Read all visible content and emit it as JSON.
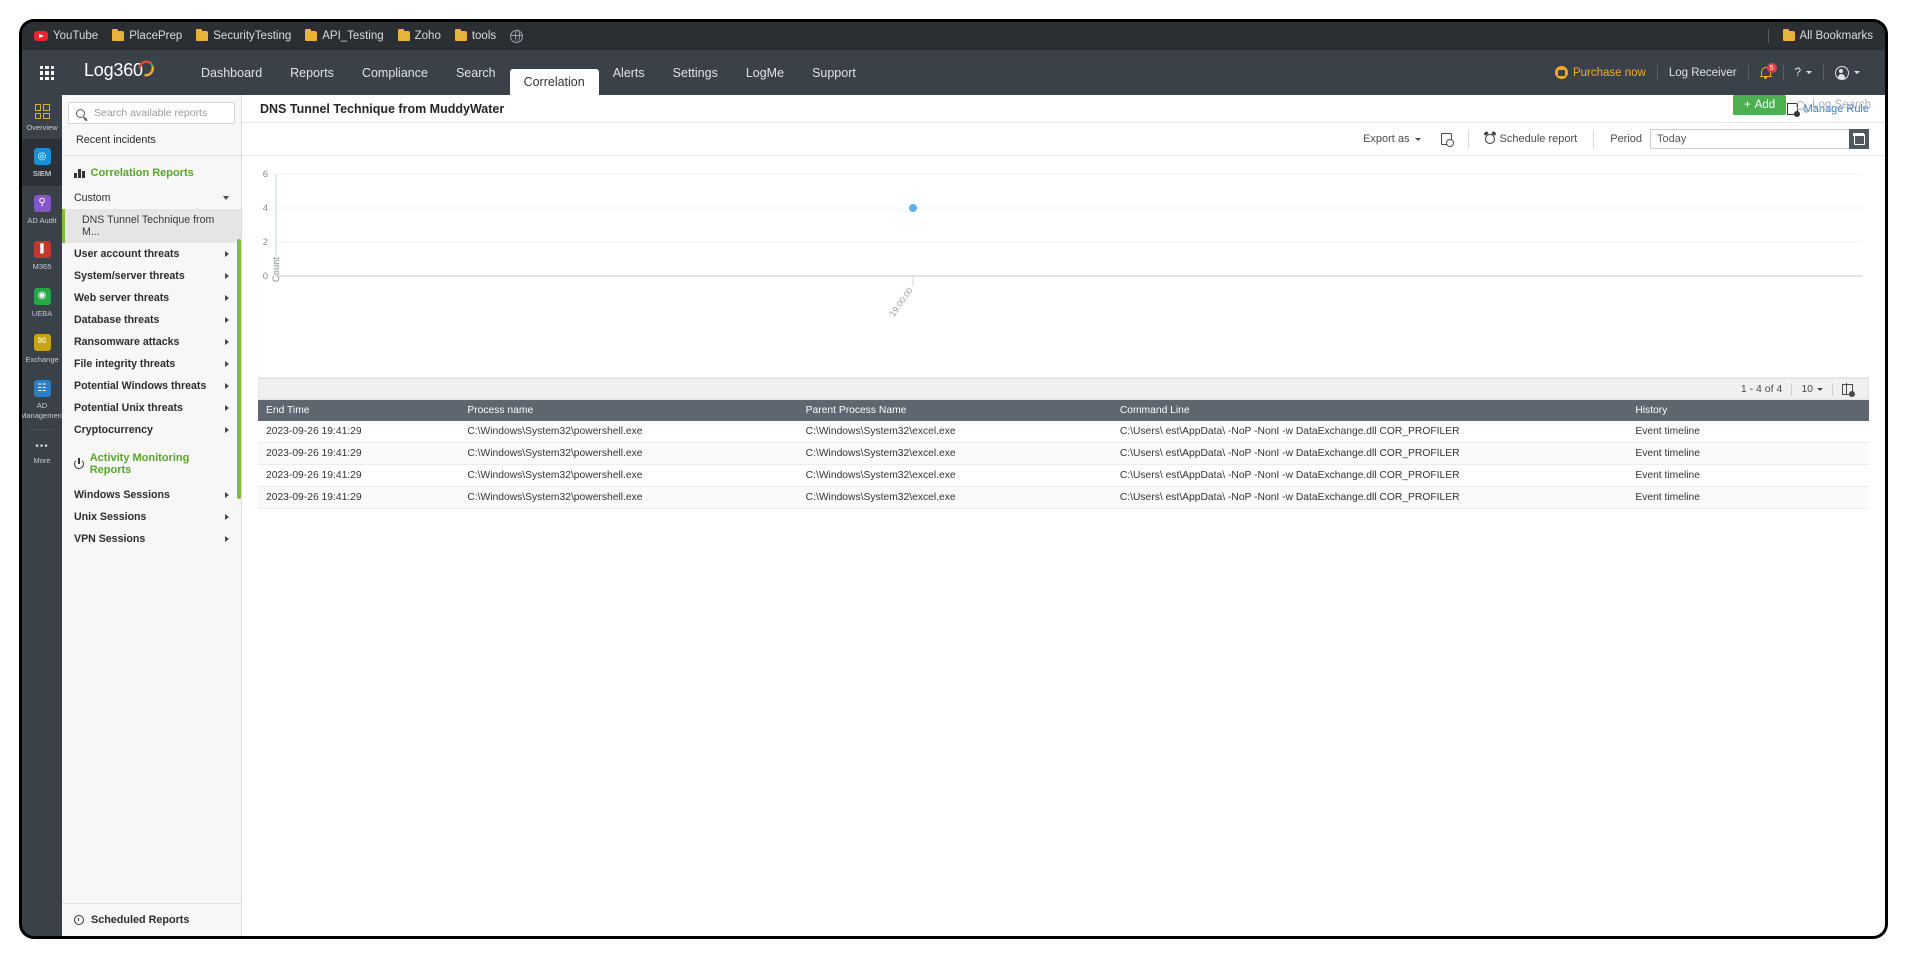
{
  "browser": {
    "bookmarks": [
      {
        "label": "YouTube",
        "icon": "youtube-icon"
      },
      {
        "label": "PlacePrep",
        "icon": "folder-icon"
      },
      {
        "label": "SecurityTesting",
        "icon": "folder-icon"
      },
      {
        "label": "API_Testing",
        "icon": "folder-icon"
      },
      {
        "label": "Zoho",
        "icon": "folder-icon"
      },
      {
        "label": "tools",
        "icon": "folder-icon"
      },
      {
        "label": "",
        "icon": "globe-icon"
      }
    ],
    "all_bookmarks_label": "All Bookmarks"
  },
  "header": {
    "brand": "Log360",
    "nav_tabs": [
      {
        "label": "Dashboard",
        "active": false
      },
      {
        "label": "Reports",
        "active": false
      },
      {
        "label": "Compliance",
        "active": false
      },
      {
        "label": "Search",
        "active": false
      },
      {
        "label": "Correlation",
        "active": true
      },
      {
        "label": "Alerts",
        "active": false
      },
      {
        "label": "Settings",
        "active": false
      },
      {
        "label": "LogMe",
        "active": false
      },
      {
        "label": "Support",
        "active": false
      }
    ],
    "purchase_label": "Purchase now",
    "log_receiver_label": "Log Receiver",
    "notification_count": "5",
    "help_label": "?",
    "add_button_label": "Add",
    "add_button_plus": "+",
    "log_search_placeholder": "Log Search",
    "accent_green": "#4caf50",
    "accent_amber": "#f0ab2d"
  },
  "rail": {
    "items": [
      {
        "label": "Overview",
        "icon": "grid-overview-icon",
        "color": "#e0a93b",
        "glyph": "",
        "active": false
      },
      {
        "label": "SIEM",
        "icon": "siem-icon",
        "color": "#1a8fd1",
        "glyph": "◎",
        "active": true
      },
      {
        "label": "AD Audit",
        "icon": "ad-audit-icon",
        "color": "#8456c7",
        "glyph": "⚲",
        "active": false
      },
      {
        "label": "M365",
        "icon": "m365-icon",
        "color": "#c0392b",
        "glyph": "❙",
        "active": false
      },
      {
        "label": "UEBA",
        "icon": "ueba-icon",
        "color": "#27a844",
        "glyph": "◉",
        "active": false
      },
      {
        "label": "Exchange",
        "icon": "exchange-icon",
        "color": "#c8a415",
        "glyph": "✉",
        "active": false
      },
      {
        "label": "AD Management",
        "icon": "ad-management-icon",
        "color": "#2e7fc1",
        "glyph": "☷",
        "active": false
      },
      {
        "label": "More",
        "icon": "more-icon",
        "color": "transparent",
        "glyph": "•••",
        "active": false
      }
    ]
  },
  "reports_panel": {
    "search_placeholder": "Search available reports",
    "recent_incidents_label": "Recent incidents",
    "correlation_group_title": "Correlation Reports",
    "activity_group_title": "Activity Monitoring Reports",
    "correlation_items": [
      {
        "label": "Custom",
        "type": "expanded",
        "caret": "down"
      },
      {
        "label": "DNS Tunnel Technique from M...",
        "type": "child",
        "selected": true
      },
      {
        "label": "User account threats",
        "type": "group",
        "caret": "right"
      },
      {
        "label": "System/server threats",
        "type": "group",
        "caret": "right"
      },
      {
        "label": "Web server threats",
        "type": "group",
        "caret": "right"
      },
      {
        "label": "Database threats",
        "type": "group",
        "caret": "right"
      },
      {
        "label": "Ransomware attacks",
        "type": "group",
        "caret": "right"
      },
      {
        "label": "File integrity threats",
        "type": "group",
        "caret": "right"
      },
      {
        "label": "Potential Windows threats",
        "type": "group",
        "caret": "right"
      },
      {
        "label": "Potential Unix threats",
        "type": "group",
        "caret": "right"
      },
      {
        "label": "Cryptocurrency",
        "type": "group",
        "caret": "right"
      }
    ],
    "activity_items": [
      {
        "label": "Windows Sessions",
        "caret": "right"
      },
      {
        "label": "Unix Sessions",
        "caret": "right"
      },
      {
        "label": "VPN Sessions",
        "caret": "right"
      }
    ],
    "scheduled_reports_label": "Scheduled Reports"
  },
  "page": {
    "title": "DNS Tunnel Technique from MuddyWater",
    "manage_rule_label": "Manage Rule"
  },
  "toolbar": {
    "export_as_label": "Export as",
    "schedule_report_label": "Schedule report",
    "period_label": "Period",
    "period_value": "Today",
    "period_placeholder": "Today"
  },
  "chart_data": {
    "type": "scatter",
    "title": "",
    "xlabel": "",
    "ylabel": "Count",
    "x": [
      "19:00:00"
    ],
    "values": [
      4
    ],
    "categories": [
      "19:00:00"
    ],
    "y_ticks": [
      0,
      2,
      4,
      6
    ],
    "ylim": [
      0,
      6
    ],
    "x_tick_labels": [
      "19:00:00"
    ],
    "grid": true,
    "legend": false,
    "point_color": "#5eb3e4"
  },
  "table": {
    "pagination_label": "1 - 4 of 4",
    "page_size": "10",
    "columns": [
      "End Time",
      "Process name",
      "Parent Process Name",
      "Command Line",
      "History"
    ],
    "rows": [
      {
        "end_time": "2023-09-26 19:41:29",
        "process_name": "C:\\Windows\\System32\\powershell.exe",
        "parent_process_name": "C:\\Windows\\System32\\excel.exe",
        "command_line": "C:\\Users\\ est\\AppData\\ -NoP -NonI -w DataExchange.dll COR_PROFILER",
        "history": "Event timeline"
      },
      {
        "end_time": "2023-09-26 19:41:29",
        "process_name": "C:\\Windows\\System32\\powershell.exe",
        "parent_process_name": "C:\\Windows\\System32\\excel.exe",
        "command_line": "C:\\Users\\ est\\AppData\\ -NoP -NonI -w DataExchange.dll COR_PROFILER",
        "history": "Event timeline"
      },
      {
        "end_time": "2023-09-26 19:41:29",
        "process_name": "C:\\Windows\\System32\\powershell.exe",
        "parent_process_name": "C:\\Windows\\System32\\excel.exe",
        "command_line": "C:\\Users\\ est\\AppData\\ -NoP -NonI -w DataExchange.dll COR_PROFILER",
        "history": "Event timeline"
      },
      {
        "end_time": "2023-09-26 19:41:29",
        "process_name": "C:\\Windows\\System32\\powershell.exe",
        "parent_process_name": "C:\\Windows\\System32\\excel.exe",
        "command_line": "C:\\Users\\ est\\AppData\\ -NoP -NonI -w DataExchange.dll COR_PROFILER",
        "history": "Event timeline"
      }
    ]
  }
}
